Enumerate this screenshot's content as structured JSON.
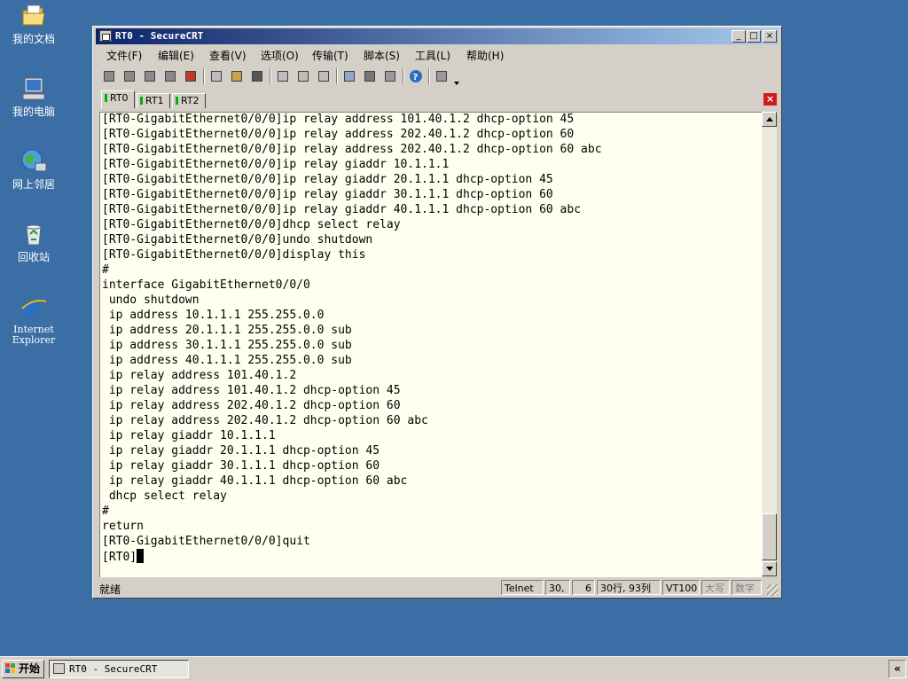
{
  "desktop": {
    "icons": [
      {
        "label": "我的文档",
        "icon": "folder-icon"
      },
      {
        "label": "我的电脑",
        "icon": "computer-icon"
      },
      {
        "label": "网上邻居",
        "icon": "network-icon"
      },
      {
        "label": "回收站",
        "icon": "recycle-bin-icon"
      },
      {
        "label": "Internet\nExplorer",
        "icon": "ie-icon"
      }
    ]
  },
  "window": {
    "title": "RT0 - SecureCRT",
    "title_bar_color": "#0a246a",
    "caption_buttons": [
      "_",
      "□",
      "×"
    ],
    "menu": [
      "文件(F)",
      "编辑(E)",
      "查看(V)",
      "选项(O)",
      "传输(T)",
      "脚本(S)",
      "工具(L)",
      "帮助(H)"
    ],
    "tabs": [
      {
        "label": "RT0",
        "active": true
      },
      {
        "label": "RT1",
        "active": false
      },
      {
        "label": "RT2",
        "active": false
      }
    ],
    "tab_close": "×",
    "terminal": {
      "background": "#fffff0",
      "lines": [
        "[RT0-GigabitEthernet0/0/0]ip relay address 101.40.1.2 dhcp-option 45",
        "[RT0-GigabitEthernet0/0/0]ip relay address 202.40.1.2 dhcp-option 60",
        "[RT0-GigabitEthernet0/0/0]ip relay address 202.40.1.2 dhcp-option 60 abc",
        "[RT0-GigabitEthernet0/0/0]ip relay giaddr 10.1.1.1",
        "[RT0-GigabitEthernet0/0/0]ip relay giaddr 20.1.1.1 dhcp-option 45",
        "[RT0-GigabitEthernet0/0/0]ip relay giaddr 30.1.1.1 dhcp-option 60",
        "[RT0-GigabitEthernet0/0/0]ip relay giaddr 40.1.1.1 dhcp-option 60 abc",
        "[RT0-GigabitEthernet0/0/0]dhcp select relay",
        "[RT0-GigabitEthernet0/0/0]undo shutdown",
        "[RT0-GigabitEthernet0/0/0]display this",
        "#",
        "interface GigabitEthernet0/0/0",
        " undo shutdown",
        " ip address 10.1.1.1 255.255.0.0",
        " ip address 20.1.1.1 255.255.0.0 sub",
        " ip address 30.1.1.1 255.255.0.0 sub",
        " ip address 40.1.1.1 255.255.0.0 sub",
        " ip relay address 101.40.1.2",
        " ip relay address 101.40.1.2 dhcp-option 45",
        " ip relay address 202.40.1.2 dhcp-option 60",
        " ip relay address 202.40.1.2 dhcp-option 60 abc",
        " ip relay giaddr 10.1.1.1",
        " ip relay giaddr 20.1.1.1 dhcp-option 45",
        " ip relay giaddr 30.1.1.1 dhcp-option 60",
        " ip relay giaddr 40.1.1.1 dhcp-option 60 abc",
        " dhcp select relay",
        "#",
        "return",
        "[RT0-GigabitEthernet0/0/0]quit"
      ],
      "prompt": "[RT0]"
    },
    "status": {
      "ready": "就绪",
      "protocol": "Telnet",
      "row": "30,",
      "col": "6",
      "size": "30行, 93列",
      "emulation": "VT100",
      "caps": "大写",
      "num": "数字"
    }
  },
  "taskbar": {
    "start_label": "开始",
    "task_label": "RT0 - SecureCRT",
    "tray_arrow": "«"
  }
}
